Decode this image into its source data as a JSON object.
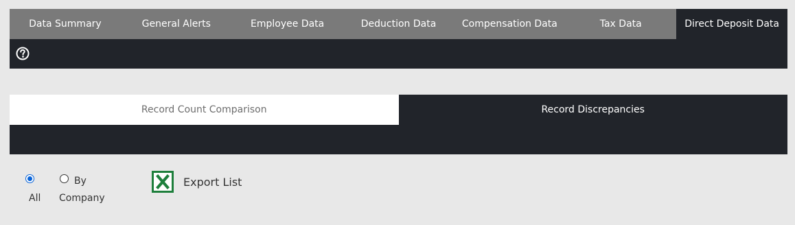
{
  "top_tabs": [
    {
      "label": "Data Summary",
      "active": false
    },
    {
      "label": "General Alerts",
      "active": false
    },
    {
      "label": "Employee Data",
      "active": false
    },
    {
      "label": "Deduction Data",
      "active": false
    },
    {
      "label": "Compensation Data",
      "active": false
    },
    {
      "label": "Tax Data",
      "active": false
    },
    {
      "label": "Direct Deposit Data",
      "active": true
    }
  ],
  "help": {
    "icon": "help-icon"
  },
  "sub_tabs": [
    {
      "label": "Record Count Comparison",
      "active": false
    },
    {
      "label": "Record Discrepancies",
      "active": true
    }
  ],
  "filter": {
    "all_label": "All",
    "all_checked": true,
    "by_label_line1": "By",
    "by_label_line2": "Company",
    "by_checked": false
  },
  "export": {
    "label": "Export List",
    "icon": "excel-icon"
  },
  "colors": {
    "dark": "#21242a",
    "tab_bg": "#7a7a7a",
    "page_bg": "#e8e8e8",
    "excel_green": "#1e7f3c",
    "radio_blue": "#0a64d8"
  }
}
